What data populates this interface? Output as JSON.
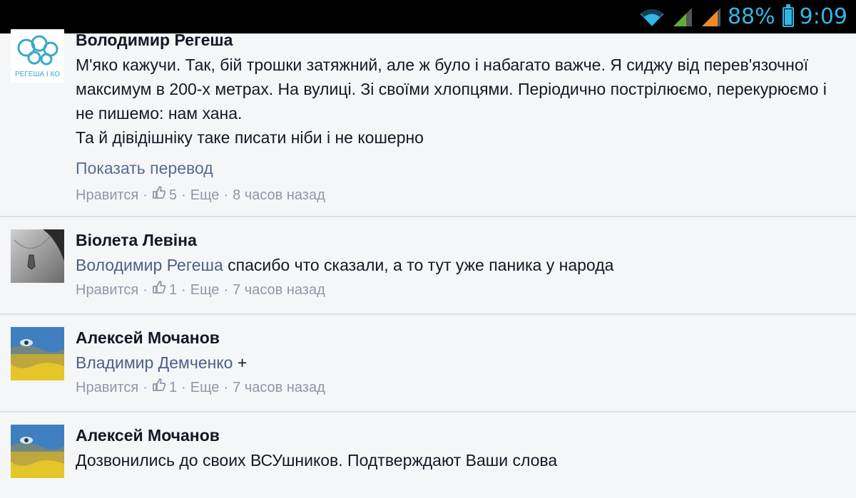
{
  "status_bar": {
    "battery_percent": "88%",
    "battery_level": 0.88,
    "time": "9:09",
    "icons": [
      "wifi-icon",
      "signal-icon",
      "signal-icon",
      "battery-icon"
    ],
    "accent_color": "#33b5e5"
  },
  "comments": [
    {
      "author": "Володимир Регеша",
      "avatar_icon": "regesha-logo-avatar",
      "avatar_text": "РЕГЕША І КО",
      "text": "М'яко кажучи. Так, бій трошки затяжний, але ж було і набагато важче. Я сиджу від перев'язочної максимум в 200-х метрах. На вулиці. Зі своїми хлопцями. Періодично пострілюємо, перекурюємо і не пишемо: нам хана.\nТа й дівідішніку таке писати ніби і не кошерно",
      "translate_link": "Показать перевод",
      "like_label": "Нравится",
      "like_count": "5",
      "more_label": "Еще",
      "time": "8 часов назад"
    },
    {
      "author": "Віолета Левіна",
      "avatar_icon": "necklace-photo-avatar",
      "mention": "Володимир Регеша",
      "text": " спасибо что сказали, а то тут уже паника у народа",
      "like_label": "Нравится",
      "like_count": "1",
      "more_label": "Еще",
      "time": "7 часов назад"
    },
    {
      "author": "Алексей Мочанов",
      "avatar_icon": "flag-face-avatar",
      "mention": "Владимир Демченко",
      "text": " +",
      "like_label": "Нравится",
      "like_count": "1",
      "more_label": "Еще",
      "time": "7 часов назад"
    },
    {
      "author": "Алексей Мочанов",
      "avatar_icon": "flag-face-avatar",
      "text": "Дозвонились до своих ВСУшников. Подтверждают Ваши слова"
    }
  ],
  "colors": {
    "background": "#f5f6f8",
    "link": "#576b95",
    "meta": "#9197a3",
    "text": "#141823"
  }
}
